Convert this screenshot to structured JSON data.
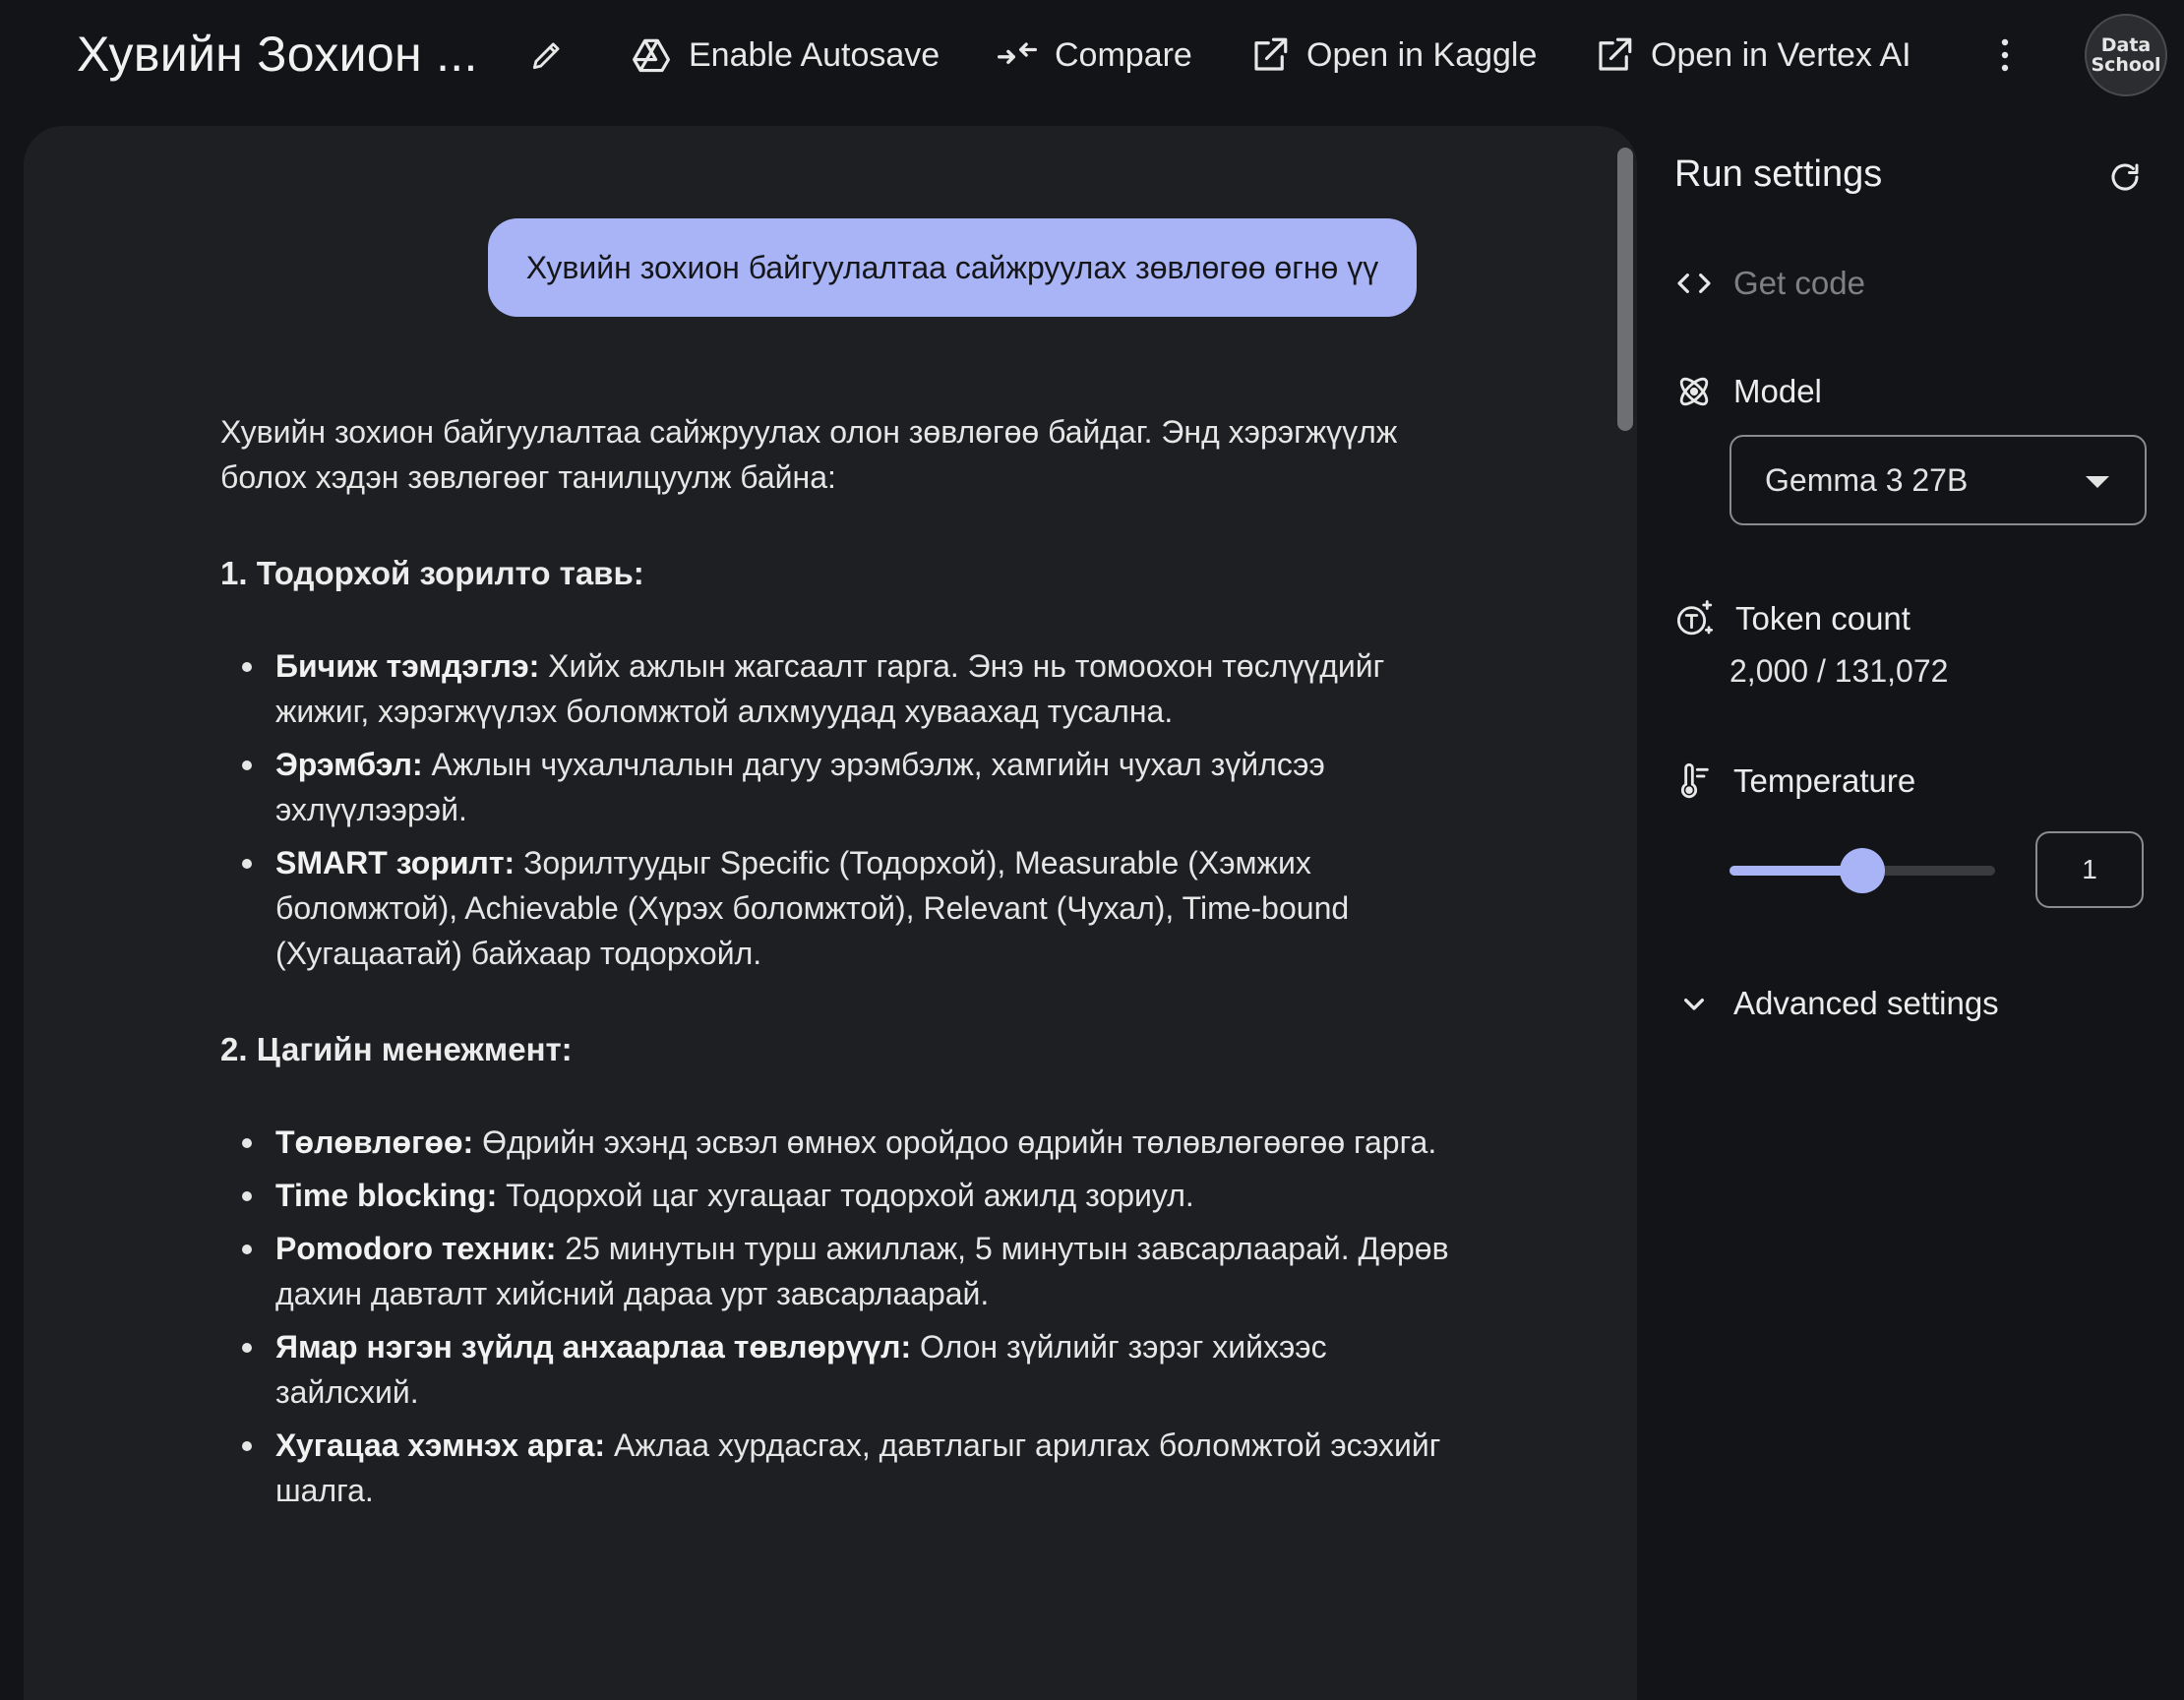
{
  "header": {
    "title": "Хувийн Зохион ...",
    "autosave_label": "Enable Autosave",
    "compare_label": "Compare",
    "kaggle_label": "Open in Kaggle",
    "vertex_label": "Open in Vertex AI",
    "avatar_text_1": "Data",
    "avatar_text_2": "School"
  },
  "chat": {
    "user_message": "Хувийн зохион байгуулалтаа сайжруулах зөвлөгөө өгнө үү",
    "intro": "Хувийн зохион байгуулалтаа сайжруулах олон зөвлөгөө байдаг. Энд хэрэгжүүлж болох хэдэн зөвлөгөөг танилцуулж байна:",
    "sections": [
      {
        "heading": "1. Тодорхой зорилто тавь:",
        "items": [
          {
            "bold": "Бичиж тэмдэглэ:",
            "text": " Хийх ажлын жагсаалт гарга. Энэ нь томоохон төслүүдийг жижиг, хэрэгжүүлэх боломжтой алхмуудад хуваахад тусална."
          },
          {
            "bold": "Эрэмбэл:",
            "text": " Ажлын чухалчлалын дагуу эрэмбэлж, хамгийн чухал зүйлсээ эхлүүлээрэй."
          },
          {
            "bold": "SMART зорилт:",
            "text": " Зорилтуудыг Specific (Тодорхой), Measurable (Хэмжих боломжтой), Achievable (Хүрэх боломжтой), Relevant (Чухал), Time-bound (Хугацаатай) байхаар тодорхойл."
          }
        ]
      },
      {
        "heading": "2. Цагийн менежмент:",
        "items": [
          {
            "bold": "Төлөвлөгөө:",
            "text": " Өдрийн эхэнд эсвэл өмнөх оройдоо өдрийн төлөвлөгөөгөө гарга."
          },
          {
            "bold": "Time blocking:",
            "text": " Тодорхой цаг хугацааг тодорхой ажилд зориул."
          },
          {
            "bold": "Pomodoro техник:",
            "text": " 25 минутын турш ажиллаж, 5 минутын завсарлаарай. Дөрөв дахин давталт хийсний дараа урт завсарлаарай."
          },
          {
            "bold": "Ямар нэгэн зүйлд анхаарлаа төвлөрүүл:",
            "text": " Олон зүйлийг зэрэг хийхээс зайлсхий."
          },
          {
            "bold": "Хугацаа хэмнэх арга:",
            "text": " Ажлаа хурдасгах, давтлагыг арилгах боломжтой эсэхийг шалга."
          }
        ]
      }
    ]
  },
  "settings": {
    "title": "Run settings",
    "get_code": "Get code",
    "model_label": "Model",
    "model_value": "Gemma 3 27B",
    "token_label": "Token count",
    "token_value": "2,000 / 131,072",
    "temperature_label": "Temperature",
    "temperature_value": "1",
    "temperature_fraction": 0.5,
    "advanced_label": "Advanced settings"
  },
  "colors": {
    "accent": "#a8b4f5",
    "background": "#131417",
    "panel": "#1e1f22"
  }
}
